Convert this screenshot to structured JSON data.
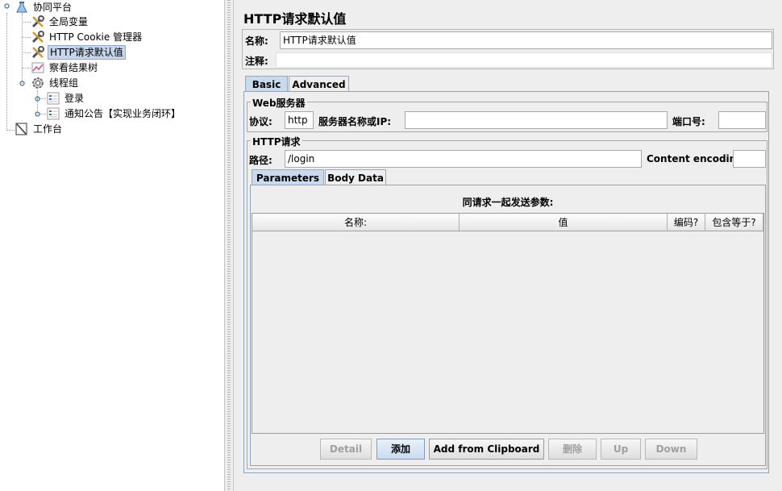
{
  "tree": {
    "root": {
      "label": "协同平台",
      "icon": "flask-icon"
    },
    "items": [
      {
        "label": "全局变量",
        "icon": "wrench-icon"
      },
      {
        "label": "HTTP Cookie 管理器",
        "icon": "wrench-icon"
      },
      {
        "label": "HTTP请求默认值",
        "icon": "wrench-icon",
        "selected": true
      },
      {
        "label": "察看结果树",
        "icon": "chart-icon"
      },
      {
        "label": "线程组",
        "icon": "gear-icon"
      },
      {
        "label": "登录",
        "icon": "sampler-icon"
      },
      {
        "label": "通知公告【实现业务闭环】",
        "icon": "sampler-icon"
      }
    ],
    "workbench": {
      "label": "工作台",
      "icon": "workbench-icon"
    }
  },
  "panel": {
    "title": "HTTP请求默认值",
    "name_label": "名称:",
    "name_value": "HTTP请求默认值",
    "comment_label": "注释:",
    "comment_value": "",
    "tabs": {
      "basic": "Basic",
      "advanced": "Advanced"
    },
    "web_server": {
      "title": "Web服务器",
      "protocol_label": "协议:",
      "protocol_value": "http",
      "server_label": "服务器名称或IP:",
      "server_value": "",
      "port_label": "端口号:",
      "port_value": ""
    },
    "http_request": {
      "title": "HTTP请求",
      "path_label": "路径:",
      "path_value": "/login",
      "encoding_label": "Content encoding:",
      "encoding_value": ""
    },
    "inner_tabs": {
      "parameters": "Parameters",
      "body_data": "Body Data"
    },
    "params_caption": "同请求一起发送参数:",
    "columns": [
      "名称:",
      "值",
      "编码?",
      "包含等于?"
    ],
    "buttons": {
      "detail": "Detail",
      "add": "添加",
      "add_clipboard": "Add from Clipboard",
      "delete": "删除",
      "up": "Up",
      "down": "Down"
    }
  }
}
